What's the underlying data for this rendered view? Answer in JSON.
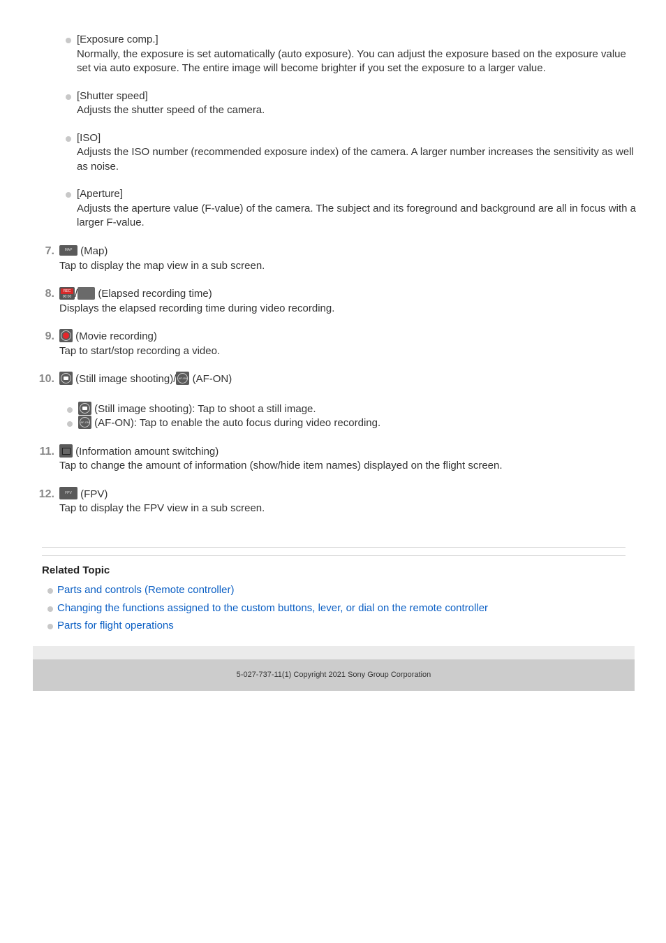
{
  "settings_items": [
    {
      "title": "[Exposure comp.]",
      "desc": "Normally, the exposure is set automatically (auto exposure). You can adjust the exposure based on the exposure value set via auto exposure. The entire image will become brighter if you set the exposure to a larger value."
    },
    {
      "title": "[Shutter speed]",
      "desc": "Adjusts the shutter speed of the camera."
    },
    {
      "title": "[ISO]",
      "desc": "Adjusts the ISO number (recommended exposure index) of the camera. A larger number increases the sensitivity as well as noise."
    },
    {
      "title": "[Aperture]",
      "desc": "Adjusts the aperture value (F-value) of the camera. The subject and its foreground and background are all in focus with a larger F-value."
    }
  ],
  "steps": {
    "s7": {
      "num": "7.",
      "icon_text": "MAP",
      "label": "(Map)",
      "desc": "Tap to display the map view in a sub screen."
    },
    "s8": {
      "num": "8.",
      "icon_rec": "REC",
      "icon_time": "00:00",
      "icon_blank": "- -",
      "sep": "/",
      "label": "(Elapsed recording time)",
      "desc": "Displays the elapsed recording time during video recording."
    },
    "s9": {
      "num": "9.",
      "label": "(Movie recording)",
      "desc": "Tap to start/stop recording a video."
    },
    "s10": {
      "num": "10.",
      "label_a": "(Still image shooting)/",
      "label_b": "(AF-ON)",
      "af_text": "AF-ON",
      "sub": [
        {
          "text": "(Still image shooting): Tap to shoot a still image."
        },
        {
          "text": "(AF-ON): Tap to enable the auto focus during video recording."
        }
      ]
    },
    "s11": {
      "num": "11.",
      "label": "(Information amount switching)",
      "desc": "Tap to change the amount of information (show/hide item names) displayed on the flight screen."
    },
    "s12": {
      "num": "12.",
      "icon_text": "FPV",
      "label": "(FPV)",
      "desc": "Tap to display the FPV view in a sub screen."
    }
  },
  "related": {
    "heading": "Related Topic",
    "links": [
      "Parts and controls (Remote controller)",
      "Changing the functions assigned to the custom buttons, lever, or dial on the remote controller",
      "Parts for flight operations"
    ]
  },
  "footer": {
    "text": "5-027-737-11(1) Copyright 2021 Sony Group Corporation"
  },
  "colors": {
    "link": "#0b5fc4",
    "rec_red": "#e6262b",
    "footer_bg": "#cccccc"
  }
}
